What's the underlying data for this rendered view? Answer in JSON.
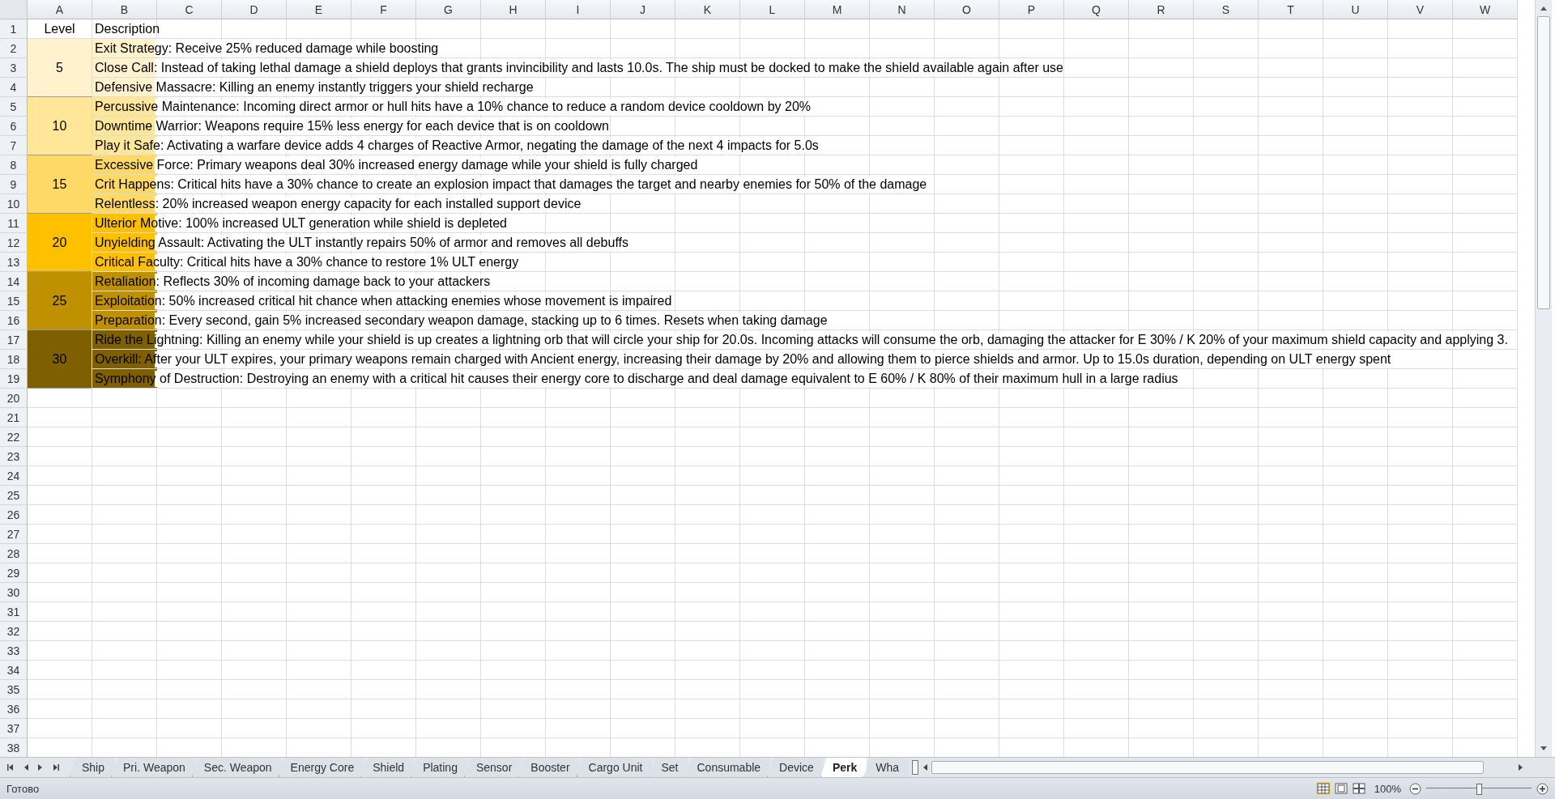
{
  "column_headers": [
    "A",
    "B",
    "C",
    "D",
    "E",
    "F",
    "G",
    "H",
    "I",
    "J",
    "K",
    "L",
    "M",
    "N",
    "O",
    "P",
    "Q",
    "R",
    "S",
    "T",
    "U",
    "V",
    "W"
  ],
  "row_numbers": [
    "1",
    "2",
    "3",
    "4",
    "5",
    "6",
    "7",
    "8",
    "9",
    "10",
    "11",
    "12",
    "13",
    "14",
    "15",
    "16",
    "17",
    "18",
    "19",
    "20",
    "21",
    "22",
    "23",
    "24",
    "25",
    "26",
    "27",
    "28",
    "29",
    "30",
    "31",
    "32",
    "33",
    "34",
    "35",
    "36",
    "37",
    "38"
  ],
  "table": {
    "headers": [
      "Level",
      "Description"
    ],
    "groups": [
      {
        "level": "5",
        "color": "#fff2cc",
        "perks": [
          "Exit Strategy: Receive 25% reduced damage while boosting",
          "Close Call: Instead of taking lethal damage a shield deploys that grants invincibility and lasts 10.0s. The ship must be docked to make the shield available again after use",
          "Defensive Massacre: Killing an enemy instantly triggers your shield recharge"
        ]
      },
      {
        "level": "10",
        "color": "#ffe699",
        "perks": [
          "Percussive Maintenance: Incoming direct armor or hull hits have a 10% chance to reduce a random device cooldown by 20%",
          "Downtime Warrior: Weapons require 15% less energy for each device that is on cooldown",
          "Play it Safe: Activating a warfare device adds 4 charges of Reactive Armor, negating the damage of the next 4 impacts for 5.0s"
        ]
      },
      {
        "level": "15",
        "color": "#ffd966",
        "perks": [
          "Excessive Force: Primary weapons deal 30% increased energy damage while your shield is fully charged",
          "Crit Happens: Critical hits have a 30% chance to create an explosion impact that damages the target and nearby enemies for 50% of the damage",
          "Relentless: 20% increased weapon energy capacity for each installed support device"
        ]
      },
      {
        "level": "20",
        "color": "#ffc000",
        "perks": [
          "Ulterior Motive: 100% increased ULT generation while shield is depleted",
          "Unyielding Assault: Activating the ULT instantly repairs 50% of armor and removes all debuffs",
          "Critical Faculty: Critical hits have a 30% chance to restore 1% ULT energy"
        ]
      },
      {
        "level": "25",
        "color": "#bf9000",
        "perks": [
          "Retaliation: Reflects 30% of incoming damage back to your attackers",
          "Exploitation: 50% increased critical hit chance when attacking enemies whose movement is impaired",
          "Preparation: Every second, gain 5% increased secondary weapon damage, stacking up to 6 times. Resets when taking damage"
        ]
      },
      {
        "level": "30",
        "color": "#7f6000",
        "perks": [
          "Ride the Lightning: Killing an enemy while your shield is up creates a lightning orb that will circle your ship for 20.0s. Incoming attacks will consume the orb, damaging the attacker for E 30% / K 20% of your maximum shield capacity and applying 3.",
          "Overkill: After your ULT expires, your primary weapons remain charged with Ancient energy, increasing their damage by 20% and allowing them to pierce shields and armor. Up to 15.0s duration, depending on ULT energy spent",
          "Symphony of Destruction: Destroying an enemy with a critical hit causes their energy core to discharge and deal damage equivalent to E 60% / K 80% of their maximum hull in a large radius"
        ]
      }
    ]
  },
  "sheet_tabs": [
    {
      "label": "Ship",
      "selected": false
    },
    {
      "label": "Pri. Weapon",
      "selected": false
    },
    {
      "label": "Sec. Weapon",
      "selected": false
    },
    {
      "label": "Energy Core",
      "selected": false
    },
    {
      "label": "Shield",
      "selected": false
    },
    {
      "label": "Plating",
      "selected": false
    },
    {
      "label": "Sensor",
      "selected": false
    },
    {
      "label": "Booster",
      "selected": false
    },
    {
      "label": "Cargo Unit",
      "selected": false
    },
    {
      "label": "Set",
      "selected": false
    },
    {
      "label": "Consumable",
      "selected": false
    },
    {
      "label": "Device",
      "selected": false
    },
    {
      "label": "Perk",
      "selected": true
    },
    {
      "label": "Wha",
      "selected": false
    }
  ],
  "status_bar": {
    "status": "Готово",
    "zoom": "100%",
    "zoom_slider": {
      "level": 0.5
    }
  }
}
